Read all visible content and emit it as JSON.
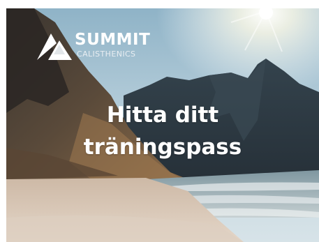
{
  "brand": {
    "name": "SUMMIT",
    "subtitle": "CALISTHENICS"
  },
  "headline": {
    "line1": "Hitta ditt",
    "line2": "träningspass"
  },
  "icons": {
    "logo": "summit-mountain-logo"
  },
  "colors": {
    "sky": "#a9c9d9",
    "mountain_dark": "#2c3840",
    "sand": "#d9c9bb",
    "text": "#ffffff"
  }
}
